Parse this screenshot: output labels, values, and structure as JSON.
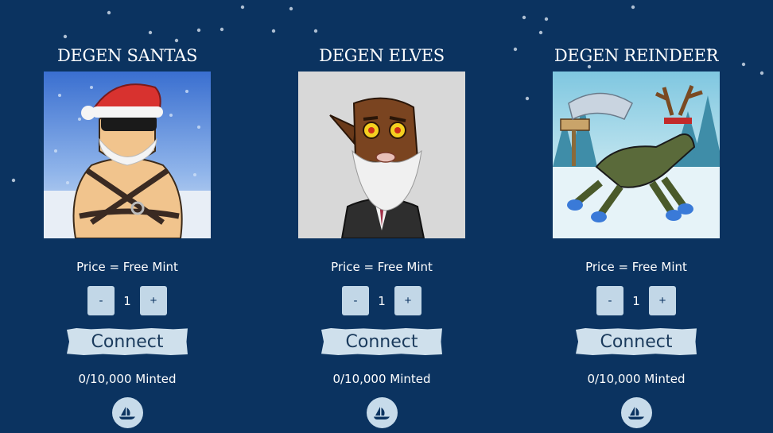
{
  "collections": [
    {
      "title": "DEGEN SANTAS",
      "price_label": "Price = Free Mint",
      "decrement_label": "-",
      "quantity": "1",
      "increment_label": "+",
      "connect_label": "Connect",
      "minted_label": "0/10,000 Minted",
      "marketplace_icon": "opensea-ship-icon"
    },
    {
      "title": "DEGEN ELVES",
      "price_label": "Price = Free Mint",
      "decrement_label": "-",
      "quantity": "1",
      "increment_label": "+",
      "connect_label": "Connect",
      "minted_label": "0/10,000 Minted",
      "marketplace_icon": "opensea-ship-icon"
    },
    {
      "title": "DEGEN REINDEER",
      "price_label": "Price = Free Mint",
      "decrement_label": "-",
      "quantity": "1",
      "increment_label": "+",
      "connect_label": "Connect",
      "minted_label": "0/10,000 Minted",
      "marketplace_icon": "opensea-ship-icon"
    }
  ],
  "colors": {
    "background": "#0b3360",
    "button_light": "#c2d7e7",
    "connect_bg": "#cfe0ec",
    "connect_text": "#1a3a5c"
  }
}
